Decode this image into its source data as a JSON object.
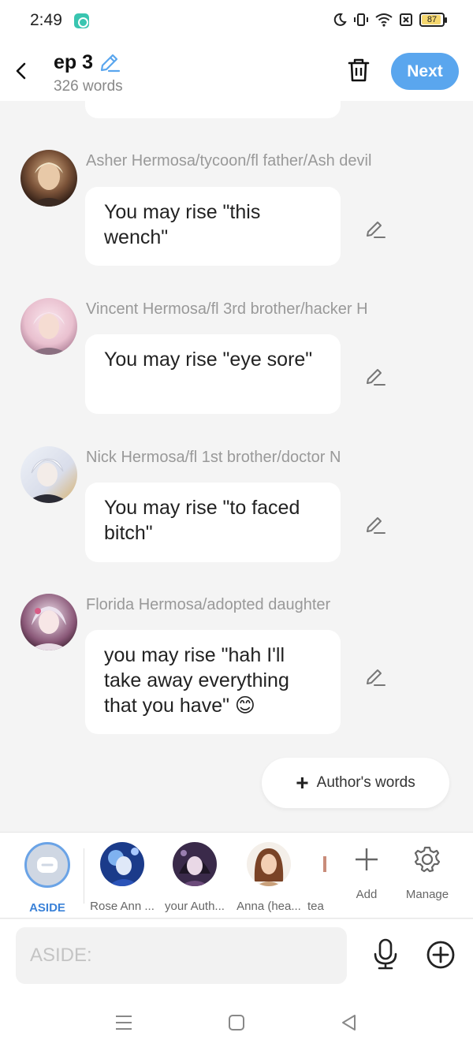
{
  "status_bar": {
    "time": "2:49",
    "battery": "87",
    "battery_level": 0.87
  },
  "header": {
    "title": "ep 3",
    "word_count": "326 words",
    "next_label": "Next"
  },
  "messages": [
    {
      "speaker": "Asher Hermosa/tycoon/fl father/Ash devil",
      "text": "You may rise \"this wench\""
    },
    {
      "speaker": "Vincent Hermosa/fl 3rd brother/hacker H",
      "text": "You may rise \"eye sore\""
    },
    {
      "speaker": "Nick Hermosa/fl 1st brother/doctor N",
      "text": "You may rise \"to faced bitch\""
    },
    {
      "speaker": "Florida Hermosa/adopted daughter",
      "text": "you may rise \"hah I'll take away everything that you have\" 😊"
    }
  ],
  "authors_words_label": "Author's words",
  "characters": [
    {
      "label": "ASIDE"
    },
    {
      "label": "Rose Ann ..."
    },
    {
      "label": "your Auth..."
    },
    {
      "label": "Anna (hea..."
    },
    {
      "label": "tea"
    }
  ],
  "tools": {
    "add_label": "Add",
    "manage_label": "Manage"
  },
  "input": {
    "placeholder": "ASIDE:"
  },
  "colors": {
    "accent": "#5aa6ee",
    "aside_label": "#3b82d8",
    "background": "#f4f4f4"
  }
}
